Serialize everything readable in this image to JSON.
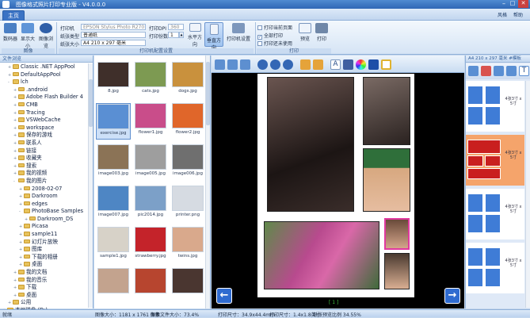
{
  "app": {
    "title": "图像格式照片打印专业版 - V4.0.0.0",
    "menu_style": "风格",
    "help": "帮助"
  },
  "tabs": [
    "主页"
  ],
  "ribbon": {
    "btn_capture": "数码器",
    "btn_display": "显示大小",
    "btn_browse": "图像浏览",
    "grp_image": "图像",
    "printer_label": "打印机",
    "printer_value": "EPSON Stylus Photo R270 Series",
    "dpi_label": "打印DPI",
    "dpi_value": "360",
    "paper_type_label": "纸张类型",
    "paper_type_value": "普通纸",
    "copies_label": "打印份数",
    "copies_value": "1",
    "paper_size_label": "纸张大小",
    "paper_size_value": "A4 210 x 297 毫米",
    "btn_landscape": "水平方向",
    "btn_portrait": "垂直方向",
    "btn_printer_setup": "打印机设置",
    "grp_print_settings": "打印机配置设置",
    "chk_print_current": "打印当前页面",
    "chk_print_all": "全部打印",
    "chk_print_unused": "打印还未使用",
    "btn_preview": "预览",
    "btn_print": "打印",
    "grp_print": "打印"
  },
  "left_panel": {
    "header": "文件浏览",
    "tree": [
      {
        "indent": 2,
        "glyph": "+",
        "label": "Classic .NET AppPool"
      },
      {
        "indent": 2,
        "glyph": "+",
        "label": "DefaultAppPool"
      },
      {
        "indent": 2,
        "glyph": "-",
        "label": "lch"
      },
      {
        "indent": 3,
        "glyph": "+",
        "label": ".android"
      },
      {
        "indent": 3,
        "glyph": "+",
        "label": "Adobe Flash Builder 4"
      },
      {
        "indent": 3,
        "glyph": "+",
        "label": "CMB"
      },
      {
        "indent": 3,
        "glyph": "+",
        "label": "Tracing"
      },
      {
        "indent": 3,
        "glyph": "+",
        "label": "VSWebCache"
      },
      {
        "indent": 3,
        "glyph": "+",
        "label": "workspace"
      },
      {
        "indent": 3,
        "glyph": "+",
        "label": "保存的游戏"
      },
      {
        "indent": 3,
        "glyph": "+",
        "label": "联系人"
      },
      {
        "indent": 3,
        "glyph": "+",
        "label": "链接"
      },
      {
        "indent": 3,
        "glyph": "+",
        "label": "收藏夹"
      },
      {
        "indent": 3,
        "glyph": "+",
        "label": "搜索"
      },
      {
        "indent": 3,
        "glyph": "+",
        "label": "我的视频"
      },
      {
        "indent": 3,
        "glyph": "-",
        "label": "我的图片"
      },
      {
        "indent": 4,
        "glyph": "+",
        "label": "2008-02-07"
      },
      {
        "indent": 4,
        "glyph": "+",
        "label": "Darkroom"
      },
      {
        "indent": 4,
        "glyph": "+",
        "label": "edges"
      },
      {
        "indent": 4,
        "glyph": "-",
        "label": "PhotoBase Samples"
      },
      {
        "indent": 5,
        "glyph": "+",
        "label": "Darkroom_DS"
      },
      {
        "indent": 4,
        "glyph": "+",
        "label": "Picasa"
      },
      {
        "indent": 4,
        "glyph": "+",
        "label": "sample11"
      },
      {
        "indent": 4,
        "glyph": "+",
        "label": "幻灯片放映"
      },
      {
        "indent": 4,
        "glyph": "+",
        "label": "图库"
      },
      {
        "indent": 4,
        "glyph": "+",
        "label": "下载的相册"
      },
      {
        "indent": 4,
        "glyph": "+",
        "label": "桌面"
      },
      {
        "indent": 3,
        "glyph": "+",
        "label": "我的文档"
      },
      {
        "indent": 3,
        "glyph": "+",
        "label": "我的音乐"
      },
      {
        "indent": 3,
        "glyph": "+",
        "label": "下载"
      },
      {
        "indent": 3,
        "glyph": "+",
        "label": "桌面"
      },
      {
        "indent": 2,
        "glyph": "+",
        "label": "公用"
      },
      {
        "indent": 1,
        "glyph": "+",
        "label": "本地磁盘 (D:)"
      }
    ]
  },
  "thumbs": [
    {
      "name": "8.jpg",
      "c": "#3f2f2a"
    },
    {
      "name": "cats.jpg",
      "c": "#7d9a52"
    },
    {
      "name": "dogs.jpg",
      "c": "#c9913d"
    },
    {
      "name": "exercise.jpg",
      "c": "#5a8fd3"
    },
    {
      "name": "flower1.jpg",
      "c": "#c94d8a"
    },
    {
      "name": "flower2.jpg",
      "c": "#e0662a"
    },
    {
      "name": "image003.jpg",
      "c": "#8b7356"
    },
    {
      "name": "image005.jpg",
      "c": "#9e9e9e"
    },
    {
      "name": "image006.jpg",
      "c": "#6f6f6f"
    },
    {
      "name": "image007.jpg",
      "c": "#4e86c4"
    },
    {
      "name": "pic2014.jpg",
      "c": "#7ca0c8"
    },
    {
      "name": "printer.png",
      "c": "#d6dbe2"
    },
    {
      "name": "sample1.jpg",
      "c": "#d7d2c8"
    },
    {
      "name": "strawberry.jpg",
      "c": "#c4232a"
    },
    {
      "name": "twins.jpg",
      "c": "#d9a98c"
    },
    {
      "name": "",
      "c": "#c3a38e"
    },
    {
      "name": "",
      "c": "#b7452f"
    },
    {
      "name": "",
      "c": "#4a3630"
    }
  ],
  "canvas": {
    "page_label": "[ 1 ]"
  },
  "right_panel": {
    "header": "A4 210 x 297 毫米 #模板",
    "templates": [
      {
        "label": "4张3寸 x 5寸",
        "bg": "#ffffff"
      },
      {
        "label": "4张3寸 x 5寸",
        "bg": "#f5a46b"
      },
      {
        "label": "4张3寸 x 5寸",
        "bg": "#ffffff"
      },
      {
        "label": "4张3寸 x 5寸",
        "bg": "#ffffff"
      }
    ]
  },
  "status": {
    "ready": "就绪",
    "image_size": "图像大小：1181 x 1761 像素",
    "print_size": "打印尺寸：34.9x44.4mm",
    "file_size": "图像文件大小：73.4%",
    "print_size2": "打印尺寸：1.4x1.8英寸",
    "zoom": "纸张预览比例 34.55%"
  },
  "colors": {
    "accent": "#2f67b5",
    "ribbon_bg": "#d5e4f5",
    "panel_bg": "#dfe9f7",
    "template_blue": "#3f7cd6",
    "template_red": "#c91f1f"
  }
}
